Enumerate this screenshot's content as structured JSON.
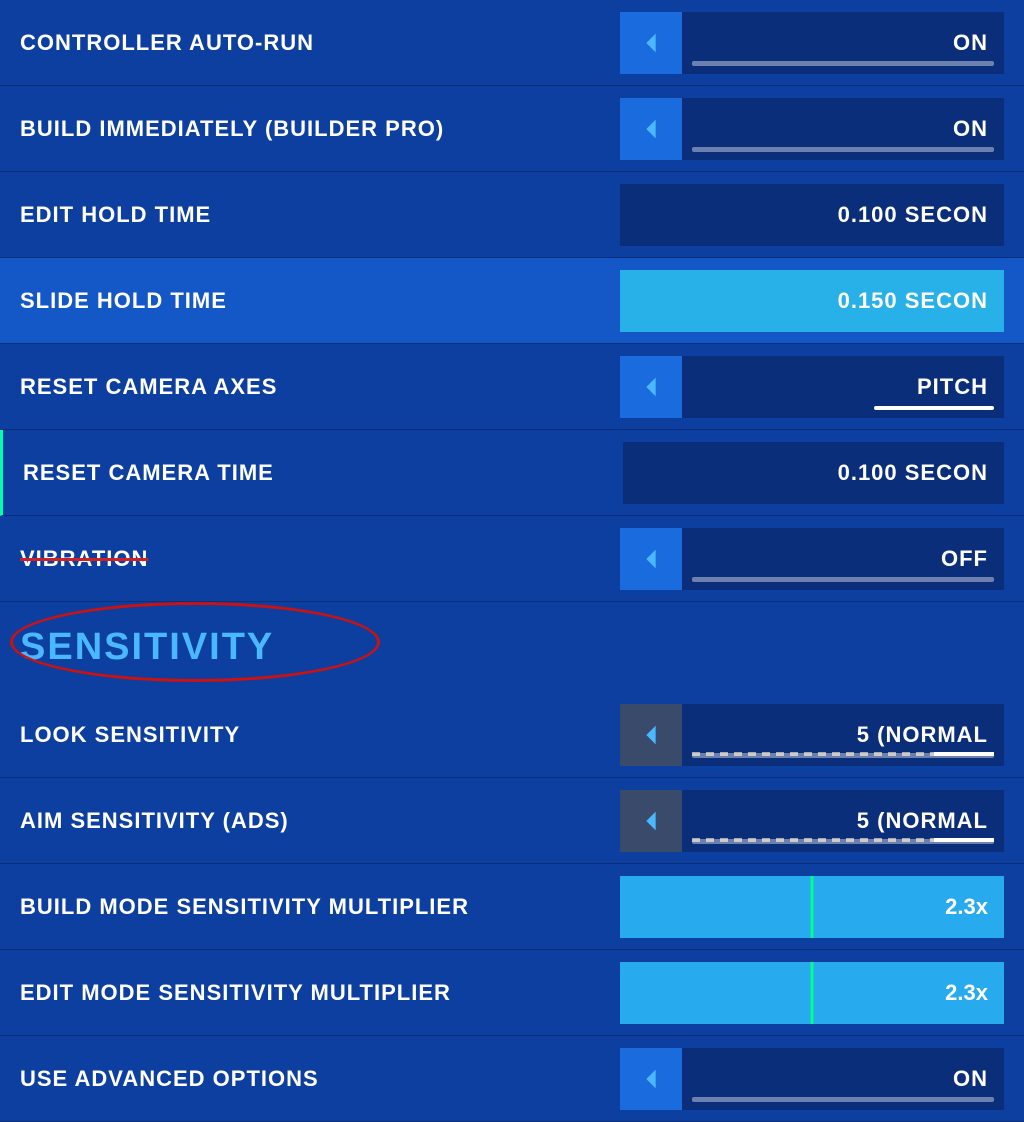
{
  "settings": {
    "rows": [
      {
        "id": "controller-auto-run",
        "label": "CONTROLLER AUTO-RUN",
        "hasArrow": true,
        "arrowDark": false,
        "value": "ON",
        "valueStyle": "normal",
        "highlighted": false
      },
      {
        "id": "build-immediately",
        "label": "BUILD IMMEDIATELY (BUILDER PRO)",
        "hasArrow": true,
        "arrowDark": false,
        "value": "ON",
        "valueStyle": "normal",
        "highlighted": false
      },
      {
        "id": "edit-hold-time",
        "label": "EDIT HOLD TIME",
        "hasArrow": false,
        "value": "0.100 Secon",
        "valueStyle": "normal",
        "highlighted": false
      },
      {
        "id": "slide-hold-time",
        "label": "SLIDE HOLD TIME",
        "hasArrow": false,
        "value": "0.150 Secon",
        "valueStyle": "lightblue",
        "highlighted": true
      },
      {
        "id": "reset-camera-axes",
        "label": "RESET CAMERA AXES",
        "hasArrow": true,
        "arrowDark": false,
        "value": "PITCH",
        "valueStyle": "pitch",
        "highlighted": false
      },
      {
        "id": "reset-camera-time",
        "label": "RESET CAMERA TIME",
        "hasArrow": false,
        "value": "0.100 Secon",
        "valueStyle": "normal",
        "highlighted": false
      },
      {
        "id": "vibration",
        "label": "VIBRATION",
        "hasArrow": true,
        "arrowDark": false,
        "value": "OFF",
        "valueStyle": "normal",
        "highlighted": false,
        "strikethrough": true
      }
    ],
    "section": {
      "title": "SENSITIVITY"
    },
    "sensitivityRows": [
      {
        "id": "look-sensitivity",
        "label": "LOOK SENSITIVITY",
        "hasArrow": true,
        "arrowDark": true,
        "value": "5 (NORMAL",
        "valueStyle": "normal",
        "hasDashedTrack": true
      },
      {
        "id": "aim-sensitivity",
        "label": "AIM SENSITIVITY (ADS)",
        "hasArrow": true,
        "arrowDark": true,
        "value": "5 (NORMAL",
        "valueStyle": "normal",
        "hasDashedTrack": true
      },
      {
        "id": "build-mode-multiplier",
        "label": "BUILD MODE SENSITIVITY MULTIPLIER",
        "hasArrow": false,
        "value": "2.3x",
        "valueStyle": "lightblue",
        "hasGreenLine": true
      },
      {
        "id": "edit-mode-multiplier",
        "label": "EDIT MODE SENSITIVITY MULTIPLIER",
        "hasArrow": false,
        "value": "2.3x",
        "valueStyle": "lightblue",
        "hasGreenLine": true
      },
      {
        "id": "use-advanced-options",
        "label": "USE ADVANCED OPTIONS",
        "hasArrow": true,
        "arrowDark": false,
        "value": "ON",
        "valueStyle": "normal"
      }
    ]
  }
}
